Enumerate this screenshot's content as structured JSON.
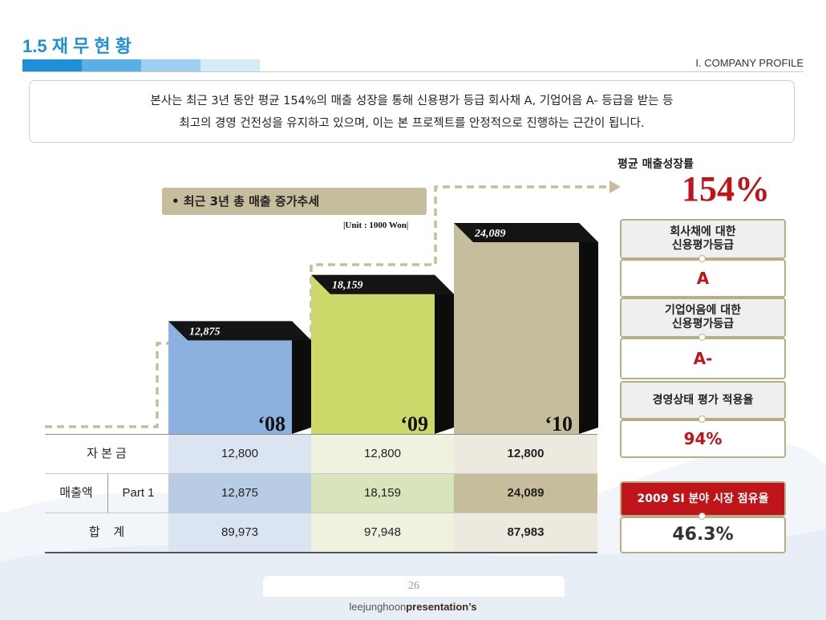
{
  "header": {
    "title": "1.5 재 무 현 황",
    "section": "I. COMPANY PROFILE",
    "accent_colors": [
      "#1f8fd8",
      "#5ab0e6",
      "#9fd0f1",
      "#d6ebf8"
    ]
  },
  "summary": {
    "line1": "본사는 최근 3년 동안 평균 154%의 매출 성장을 통해 신용평가 등급 회사채 A, 기업어음 A- 등급을 받는 등",
    "line2": "최고의 경영 건전성을 유지하고 있으며, 이는 본 프로젝트를 안정적으로 진행하는 근간이 됩니다."
  },
  "chart_label": "• 최근 3년 총 매출 증가추세",
  "unit": "|Unit : 1000 Won|",
  "chart_data": {
    "type": "bar",
    "title": "• 최근 3년 총 매출 증가추세",
    "unit": "|Unit : 1000 Won|",
    "categories": [
      "‘08",
      "‘09",
      "‘10"
    ],
    "values": [
      12875,
      18159,
      24089
    ],
    "value_labels": [
      "12,875",
      "18,159",
      "24,089"
    ],
    "colors": [
      "#8cb1df",
      "#cdd86a",
      "#c6bd9c"
    ]
  },
  "table": {
    "rows": [
      {
        "label": "자 본 금",
        "sublabel": "",
        "values": [
          "12,800",
          "12,800",
          "12,800"
        ]
      },
      {
        "label": "매출액",
        "sublabel": "Part 1",
        "values": [
          "12,875",
          "18,159",
          "24,089"
        ]
      },
      {
        "label": "합    계",
        "sublabel": "",
        "values": [
          "89,973",
          "97,948",
          "87,983"
        ]
      }
    ]
  },
  "right_panel": {
    "avg_label": "평균 매출성장률",
    "avg_value": "154%",
    "cards": [
      {
        "head_line1": "회사채에 대한",
        "head_line2": "신용평가등급",
        "value": "A"
      },
      {
        "head_line1": "기업어음에 대한",
        "head_line2": "신용평가등급",
        "value": "A-"
      },
      {
        "head_line1": "경영상태 평가 적용율",
        "head_line2": "",
        "value": "94%"
      }
    ],
    "share_label": "2009 SI 분야 시장 점유율",
    "share_value": "46.3%"
  },
  "footer": {
    "page_number": "26",
    "brand_name": "leejunghoon",
    "brand_suffix": "presentation’s"
  }
}
